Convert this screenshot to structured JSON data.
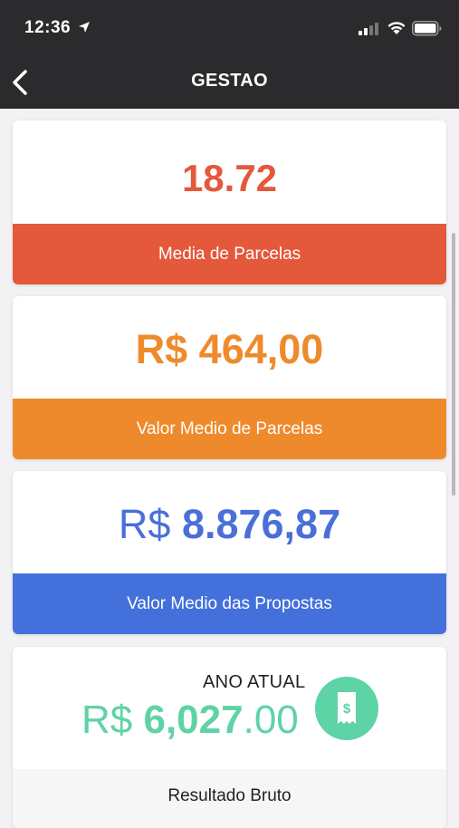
{
  "status_bar": {
    "time": "12:36"
  },
  "nav": {
    "title": "GESTAO"
  },
  "cards": [
    {
      "value": "18.72",
      "label": "Media de Parcelas",
      "color": "#e4583c"
    },
    {
      "value": "R$ 464,00",
      "label": "Valor Medio de Parcelas",
      "color": "#ef8a2c"
    },
    {
      "currency": "R$",
      "amount": "8.876,87",
      "label": "Valor Medio das Propostas",
      "color": "#4470dc"
    }
  ],
  "annual": {
    "label": "ANO ATUAL",
    "currency": "R$",
    "amount": "6,027",
    "cents": ".00",
    "footer": "Resultado Bruto",
    "icon": "receipt-dollar-icon",
    "color": "#5ed3a6"
  }
}
